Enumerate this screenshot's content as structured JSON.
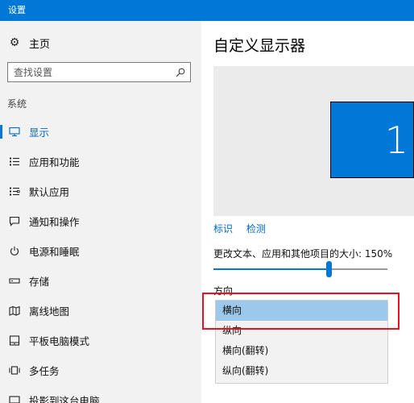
{
  "window": {
    "title": "设置"
  },
  "sidebar": {
    "home_label": "主页",
    "search_placeholder": "查找设置",
    "section_label": "系统",
    "items": [
      {
        "label": "显示",
        "icon": "monitor-icon",
        "active": true
      },
      {
        "label": "应用和功能",
        "icon": "app-list-icon",
        "active": false
      },
      {
        "label": "默认应用",
        "icon": "default-apps-icon",
        "active": false
      },
      {
        "label": "通知和操作",
        "icon": "notification-icon",
        "active": false
      },
      {
        "label": "电源和睡眠",
        "icon": "power-icon",
        "active": false
      },
      {
        "label": "存储",
        "icon": "storage-icon",
        "active": false
      },
      {
        "label": "离线地图",
        "icon": "map-icon",
        "active": false
      },
      {
        "label": "平板电脑模式",
        "icon": "tablet-icon",
        "active": false
      },
      {
        "label": "多任务",
        "icon": "multitask-icon",
        "active": false
      },
      {
        "label": "投影到这台电脑",
        "icon": "project-icon",
        "active": false
      }
    ]
  },
  "main": {
    "title": "自定义显示器",
    "monitor_number": "1",
    "identify_link": "标识",
    "detect_link": "检测",
    "scale_label": "更改文本、应用和其他项目的大小: 150%",
    "scale_fraction": 0.66,
    "orientation_label": "方向",
    "orientation_options": [
      "横向",
      "纵向",
      "横向(翻转)",
      "纵向(翻转)"
    ],
    "orientation_selected": 0
  },
  "colors": {
    "accent": "#0078d7",
    "highlight": "#e81123",
    "selected": "#9cc8ec"
  }
}
